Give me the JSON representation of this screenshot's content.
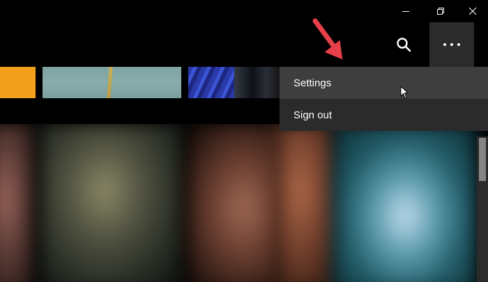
{
  "window_controls": {
    "minimize_icon": "minimize-icon",
    "maximize_icon": "restore-icon",
    "close_icon": "close-icon"
  },
  "toolbar": {
    "search_icon": "search-icon",
    "more_icon": "more-horizontal-icon"
  },
  "menu": {
    "items": [
      {
        "label": "Settings"
      },
      {
        "label": "Sign out"
      }
    ]
  },
  "colors": {
    "menu_hover": "#3e3e3e",
    "menu_bg": "#2b2b2b",
    "annotation_arrow": "#e8404a"
  }
}
